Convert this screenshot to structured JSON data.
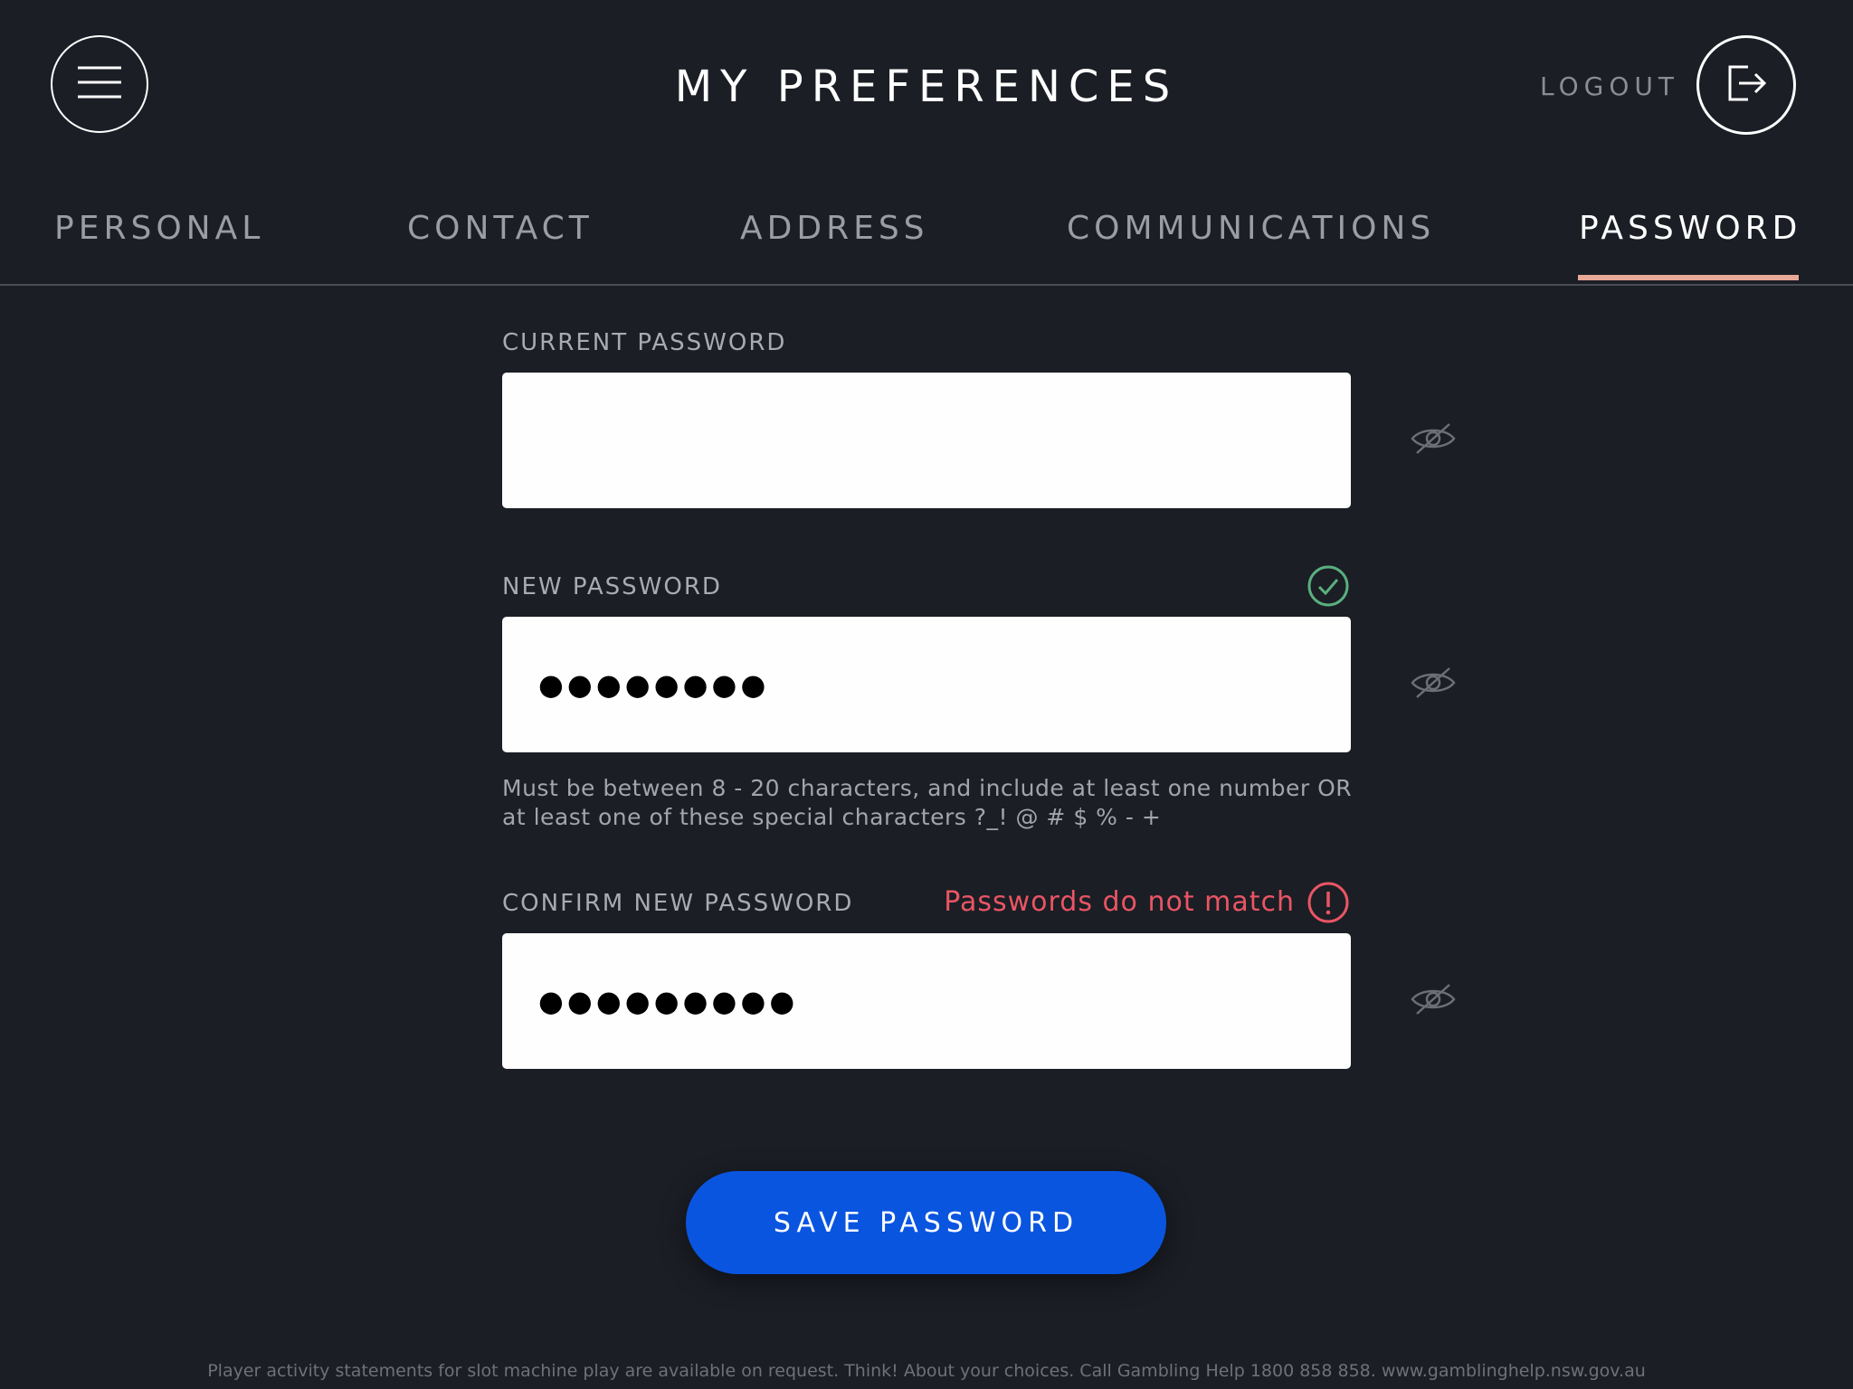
{
  "header": {
    "title": "MY PREFERENCES",
    "logout_label": "LOGOUT",
    "menu_icon": "hamburger-menu-icon",
    "logout_icon": "logout-exit-icon"
  },
  "tabs": [
    {
      "label": "PERSONAL",
      "active": false
    },
    {
      "label": "CONTACT",
      "active": false
    },
    {
      "label": "ADDRESS",
      "active": false
    },
    {
      "label": "COMMUNICATIONS",
      "active": false
    },
    {
      "label": "PASSWORD",
      "active": true
    }
  ],
  "form": {
    "current_password": {
      "label": "CURRENT PASSWORD",
      "value": ""
    },
    "new_password": {
      "label": "NEW PASSWORD",
      "value": "●●●●●●●●",
      "status": "valid",
      "hint": "Must be between 8 - 20 characters, and include at least one number OR at least one of these special characters ?_! @ # $ % - +"
    },
    "confirm_password": {
      "label": "CONFIRM NEW PASSWORD",
      "value": "●●●●●●●●●",
      "error": "Passwords do not match"
    },
    "save_label": "SAVE PASSWORD"
  },
  "footer": {
    "text": "Player activity statements for slot machine play are available on request. Think! About your choices. Call Gambling Help 1800 858 858. www.gamblinghelp.nsw.gov.au"
  },
  "colors": {
    "background": "#1b1e25",
    "accent_underline": "#e8a996",
    "button": "#0a55e0",
    "error": "#ea5564",
    "valid": "#5aaf7e"
  }
}
